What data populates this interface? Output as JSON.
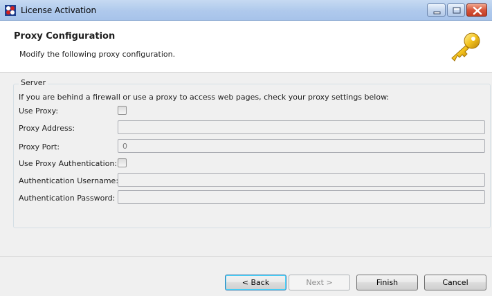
{
  "window": {
    "title": "License Activation",
    "icon": "app-logo-icon"
  },
  "header": {
    "title": "Proxy Configuration",
    "description": "Modify the following proxy configuration.",
    "icon": "key-icon"
  },
  "server_group": {
    "label": "Server",
    "help_text": "If you are behind a firewall or use a proxy to access web pages, check your proxy settings below:",
    "use_proxy": {
      "label": "Use Proxy:",
      "checked": false
    },
    "proxy_address": {
      "label": "Proxy Address:",
      "value": ""
    },
    "proxy_port": {
      "label": "Proxy Port:",
      "value": "0"
    },
    "use_proxy_auth": {
      "label": "Use Proxy Authentication:",
      "checked": false
    },
    "auth_username": {
      "label": "Authentication Username:",
      "value": ""
    },
    "auth_password": {
      "label": "Authentication Password:",
      "value": ""
    }
  },
  "buttons": {
    "back": "< Back",
    "next": "Next >",
    "finish": "Finish",
    "cancel": "Cancel"
  },
  "colors": {
    "title_bar": "#afc9ec",
    "content_bg": "#f0f0f0",
    "close_button": "#d6553b"
  }
}
